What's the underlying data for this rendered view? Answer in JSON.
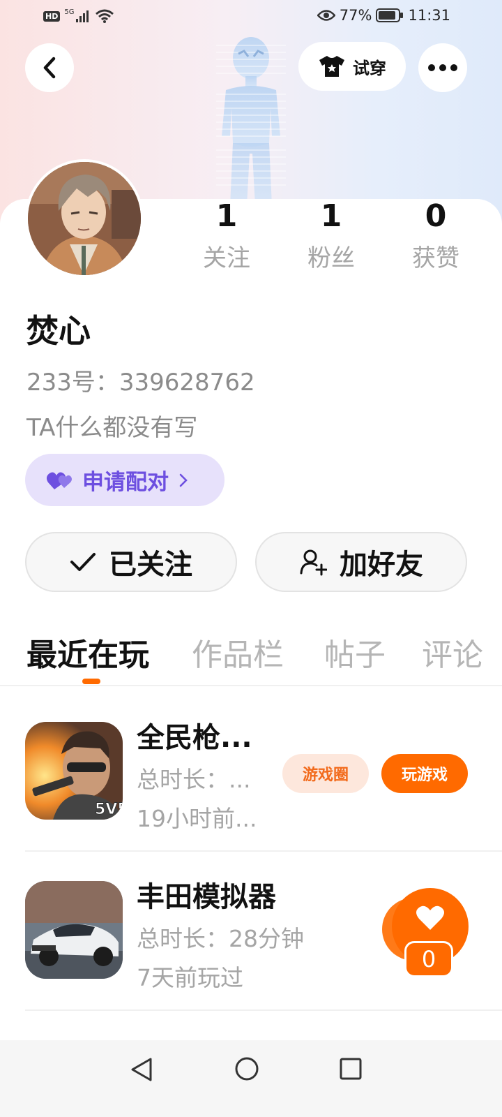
{
  "status_bar": {
    "hd": "HD",
    "network": "5G",
    "battery_percent": "77%",
    "time": "11:31",
    "icons": [
      "signal-icon",
      "wifi-icon",
      "eye-icon",
      "battery-icon"
    ]
  },
  "header": {
    "try_on_label": "试穿",
    "icons": [
      "back-icon",
      "tshirt-icon",
      "more-icon"
    ]
  },
  "profile": {
    "name": "焚心",
    "id_line": "233号：339628762",
    "bio": "TA什么都没有写",
    "stats": [
      {
        "value": "1",
        "label": "关注"
      },
      {
        "value": "1",
        "label": "粉丝"
      },
      {
        "value": "0",
        "label": "获赞"
      }
    ],
    "pair_label": "申请配对"
  },
  "actions": {
    "follow_label": "已关注",
    "add_friend_label": "加好友"
  },
  "tabs": [
    {
      "label": "最近在玩",
      "active": true
    },
    {
      "label": "作品栏",
      "active": false
    },
    {
      "label": "帖子",
      "active": false
    },
    {
      "label": "评论",
      "active": false
    }
  ],
  "games": [
    {
      "title": "全民枪...",
      "duration": "总时长：...",
      "last_played": "19小时前...",
      "circle_label": "游戏圈",
      "play_label": "玩游戏"
    },
    {
      "title": "丰田模拟器",
      "duration": "总时长：28分钟",
      "last_played": "7天前玩过"
    }
  ],
  "like_float": {
    "count": "0"
  },
  "colors": {
    "accent": "#ff6a00",
    "pair_bg": "#e7e1fb",
    "pair_text": "#6d4fe0",
    "muted_text": "#a5a5a5"
  }
}
